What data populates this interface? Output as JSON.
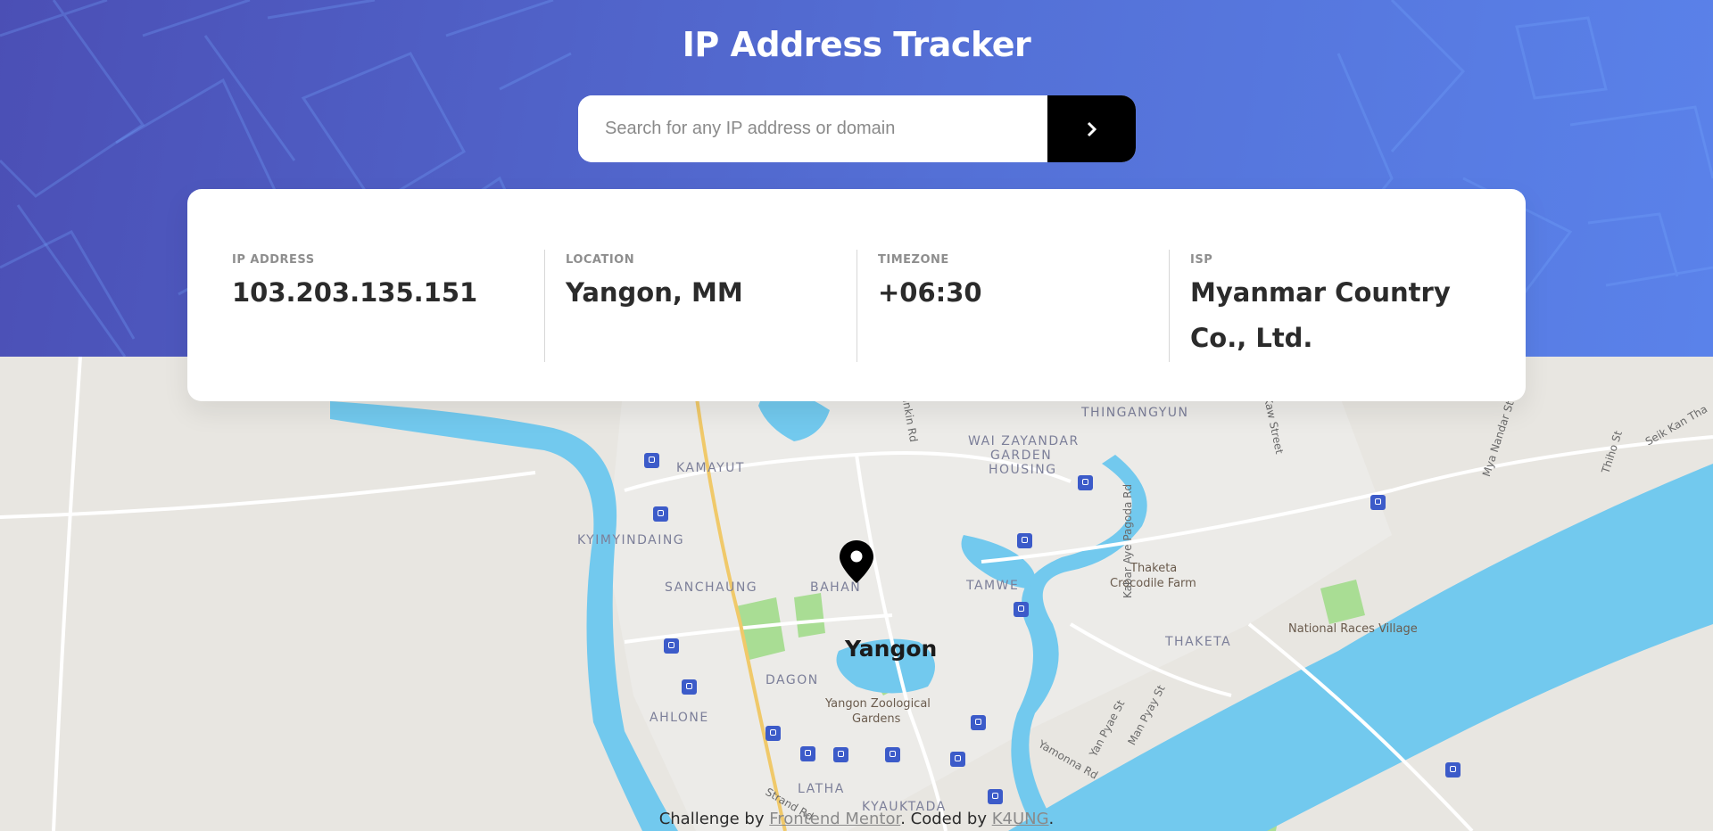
{
  "app": {
    "title": "IP Address Tracker"
  },
  "search": {
    "placeholder": "Search for any IP address or domain",
    "value": "",
    "submit_icon": "chevron-right-icon"
  },
  "stats": [
    {
      "label": "IP ADDRESS",
      "value": "103.203.135.151"
    },
    {
      "label": "LOCATION",
      "value": "Yangon, MM"
    },
    {
      "label": "TIMEZONE",
      "value": "+06:30"
    },
    {
      "label": "ISP",
      "value": "Myanmar Country Co., Ltd."
    }
  ],
  "map": {
    "city": "Yangon",
    "marker_icon": "location-pin-icon",
    "districts": [
      "THINGANGYUN",
      "WAI ZAYANDAR",
      "GARDEN",
      "HOUSING",
      "KAMAYUT",
      "KYIMYINDAING",
      "SANCHAUNG",
      "BAHAN",
      "TAMWE",
      "THAKETA",
      "DAGON",
      "AHLONE",
      "LATHA",
      "KYAUKTADA"
    ],
    "pois": [
      "Thaketa",
      "Crocodile Farm",
      "National Races Village",
      "Yangon Zoological",
      "Gardens"
    ],
    "streets": [
      "Kabar Aye Pagoda Rd",
      "Yankin Rd",
      "Kaw Street",
      "Mya Nandar St",
      "Thiho St",
      "Seik Kan Tha",
      "Yan Pyae St",
      "Man Pyay St",
      "Yamonna Rd",
      "Strand Rd"
    ]
  },
  "attribution": {
    "prefix": "Challenge by ",
    "link1": "Frontend Mentor",
    "middle": ". Coded by ",
    "link2": "K4UNG",
    "suffix": "."
  },
  "colors": {
    "header_gradient_start": "#4b4fb5",
    "header_gradient_end": "#5a82ea",
    "water": "#72c9ee",
    "land": "#e8e6e1",
    "park": "#a9dd94",
    "train_badge": "#3c5bc9"
  }
}
